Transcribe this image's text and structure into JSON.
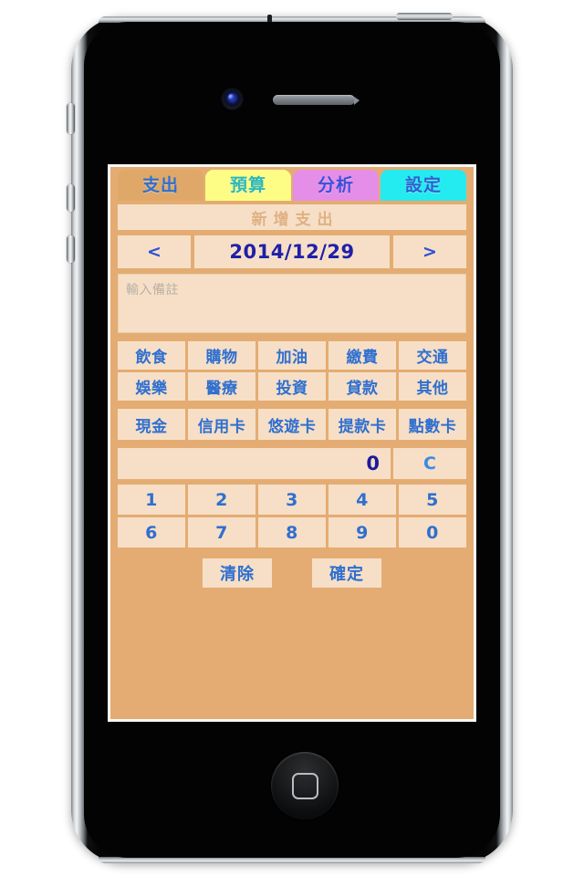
{
  "device": {
    "name": "iphone-4",
    "camera_label": "front-camera",
    "speaker_label": "earpiece-speaker",
    "home_button_label": "home-button"
  },
  "app": {
    "tabs": [
      {
        "label": "支出",
        "bg": "#e0a868",
        "fg": "#2f6fd0",
        "active": true
      },
      {
        "label": "預算",
        "bg": "#fdfd86",
        "fg": "#2fb8b8",
        "active": false
      },
      {
        "label": "分析",
        "bg": "#e48ee8",
        "fg": "#3a4fd8",
        "active": false
      },
      {
        "label": "設定",
        "bg": "#24ebef",
        "fg": "#2f5fd0",
        "active": false
      }
    ],
    "title": "新增支出",
    "date": {
      "prev_label": "<",
      "value": "2014/12/29",
      "next_label": ">"
    },
    "note": {
      "value": "",
      "placeholder": "輸入備註"
    },
    "categories": [
      [
        "飲食",
        "購物",
        "加油",
        "繳費",
        "交通"
      ],
      [
        "娛樂",
        "醫療",
        "投資",
        "貸款",
        "其他"
      ]
    ],
    "payments": [
      "現金",
      "信用卡",
      "悠遊卡",
      "提款卡",
      "點數卡"
    ],
    "amount": {
      "value": "0",
      "clear_key_label": "C"
    },
    "keypad": [
      [
        "1",
        "2",
        "3",
        "4",
        "5"
      ],
      [
        "6",
        "7",
        "8",
        "9",
        "0"
      ]
    ],
    "actions": {
      "clear_label": "清除",
      "confirm_label": "確定"
    },
    "colors": {
      "screen_bg": "#e4ac72",
      "button_bg": "#f6dfc6",
      "text_blue": "#2f6fd0",
      "amount_blue": "#1a1a9e",
      "title_muted": "#dfb184"
    }
  }
}
